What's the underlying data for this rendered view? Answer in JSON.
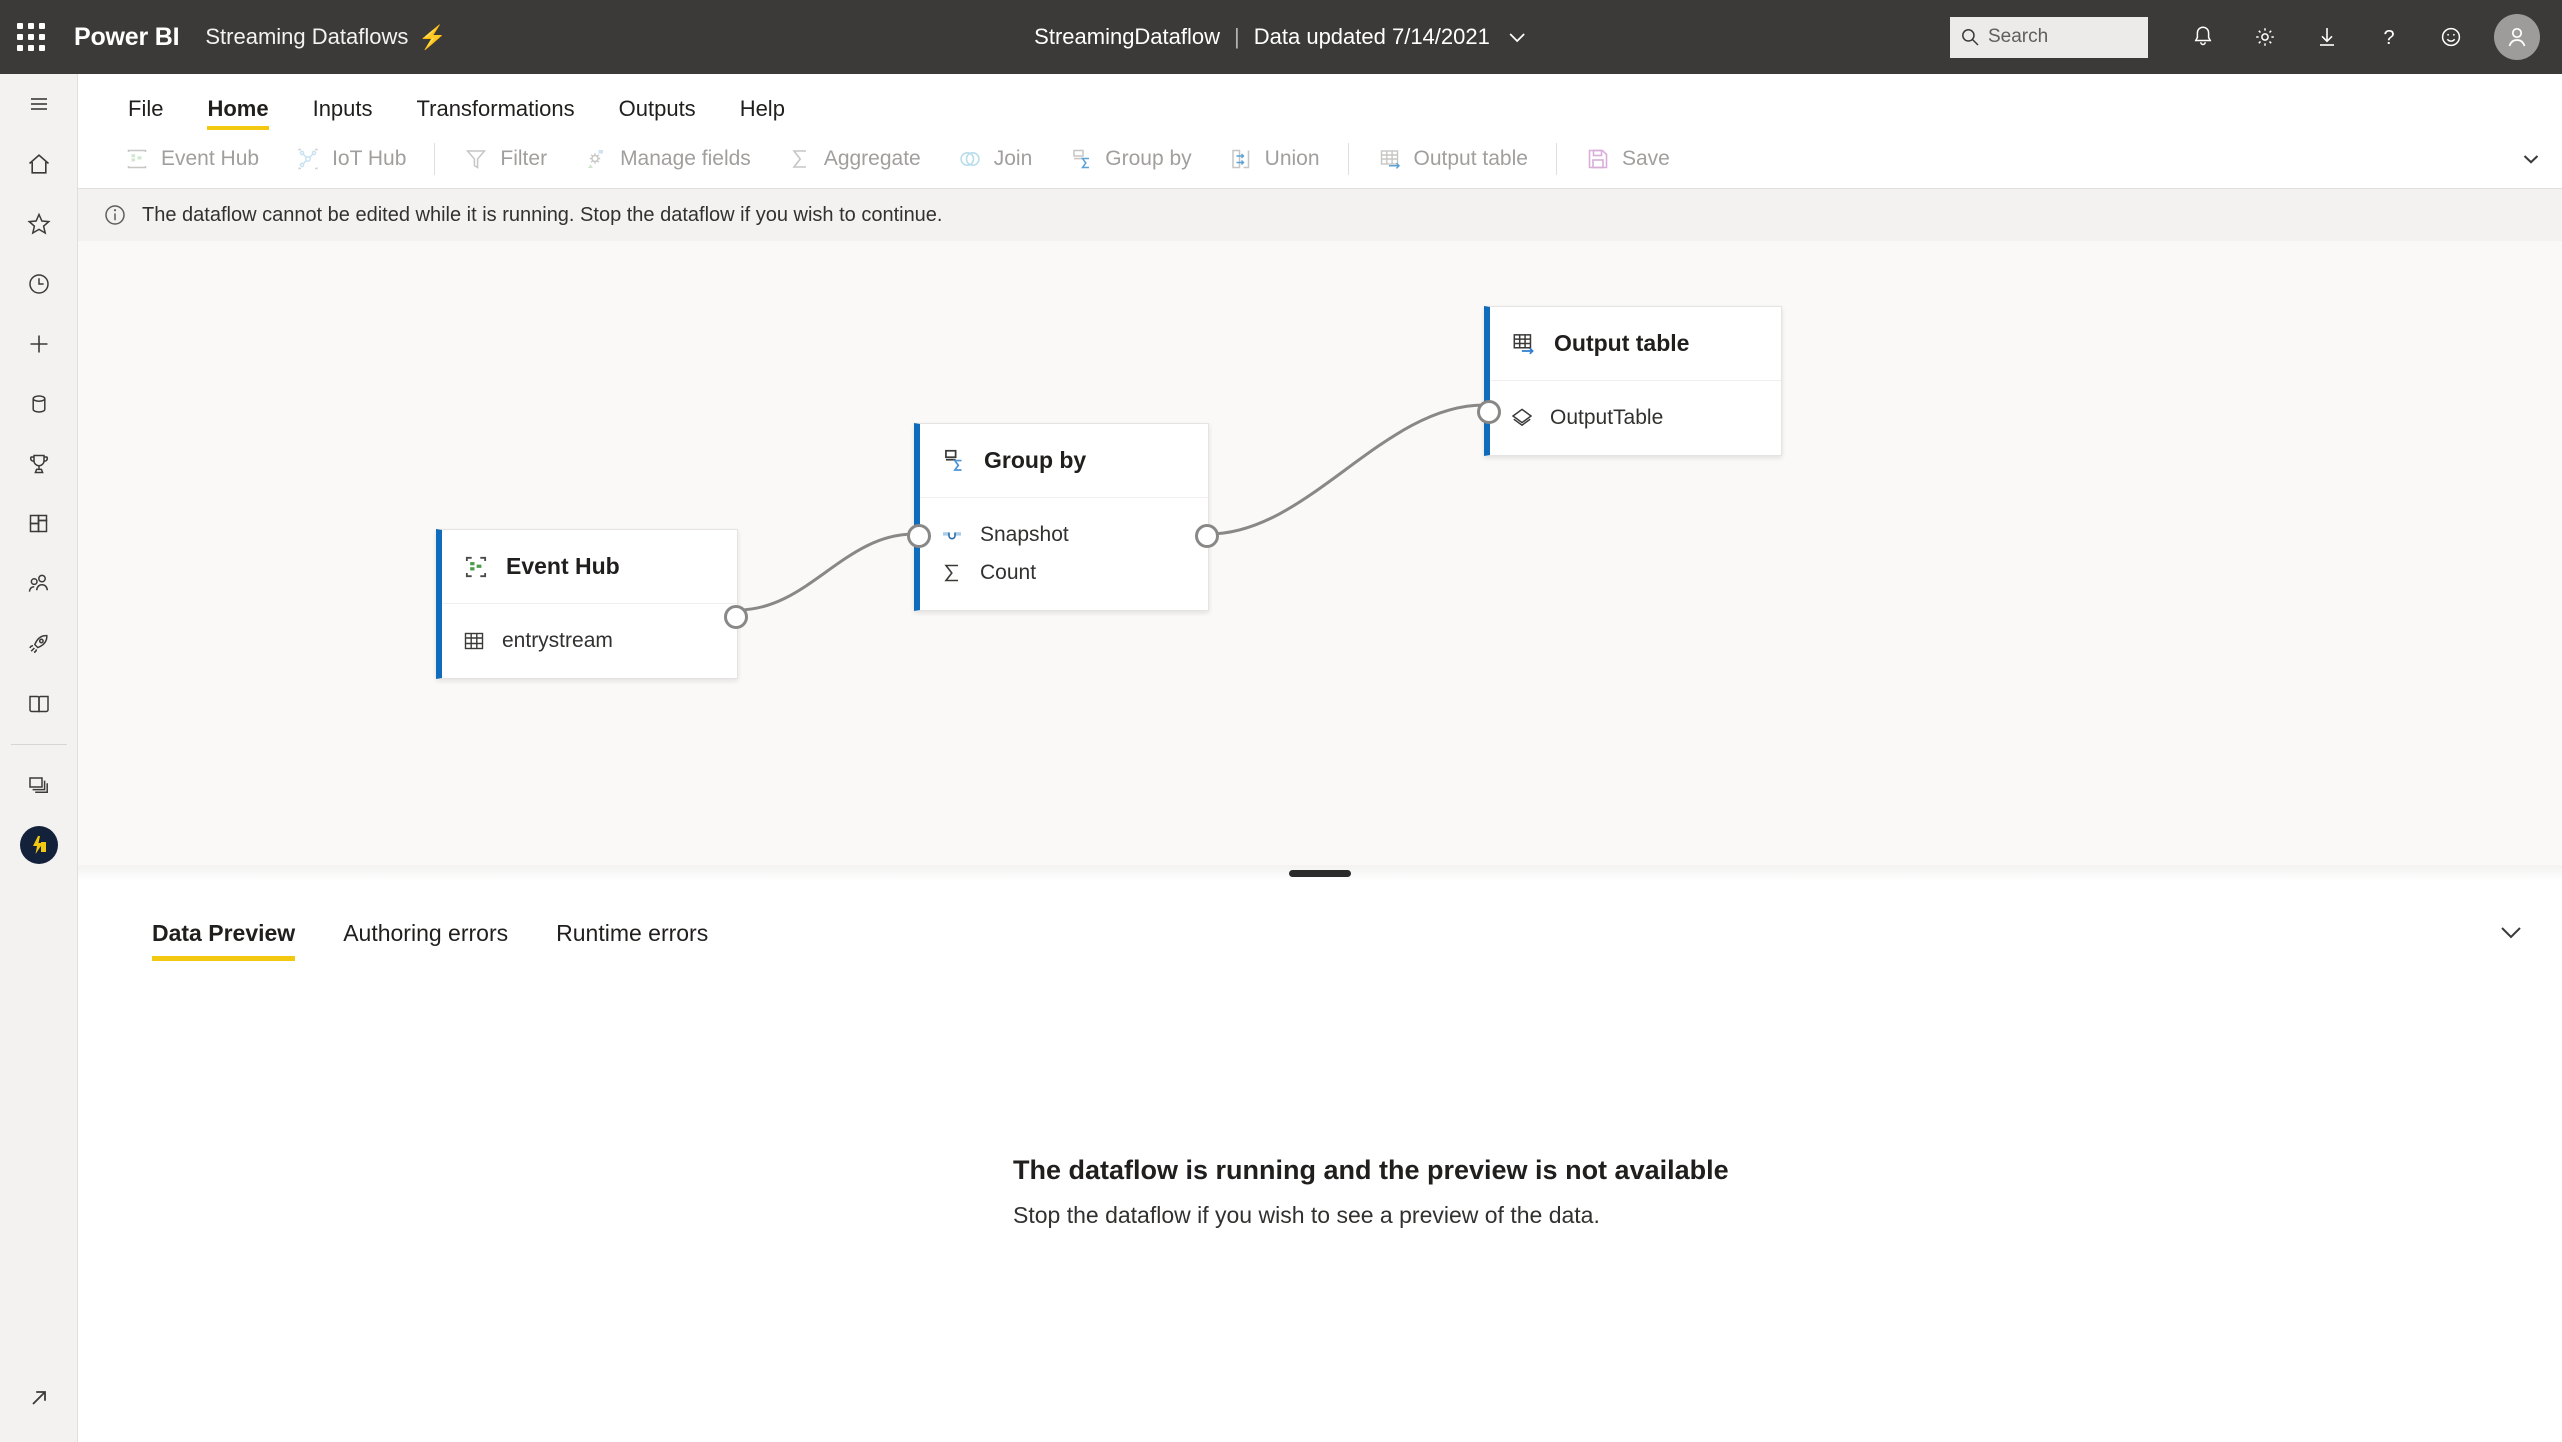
{
  "topbar": {
    "waffle_label": "app-launcher",
    "brand": "Power BI",
    "app_name": "Streaming Dataflows",
    "bolt_glyph": "⚡",
    "center": {
      "dataflow_name": "StreamingDataflow",
      "separator": "|",
      "updated_label": "Data updated 7/14/2021"
    },
    "search": {
      "placeholder": "Search",
      "value": "Search"
    },
    "icons": [
      {
        "name": "notifications-icon",
        "label": "Notifications"
      },
      {
        "name": "settings-gear-icon",
        "label": "Settings"
      },
      {
        "name": "download-icon",
        "label": "Download"
      },
      {
        "name": "help-question-icon",
        "label": "Help"
      },
      {
        "name": "feedback-smiley-icon",
        "label": "Feedback"
      }
    ],
    "avatar_label": "Account manager"
  },
  "rail": {
    "items": [
      {
        "name": "hamburger-menu-icon",
        "label": "Navigation"
      },
      {
        "name": "home-icon",
        "label": "Home"
      },
      {
        "name": "favorites-star-icon",
        "label": "Favorites"
      },
      {
        "name": "recent-clock-icon",
        "label": "Recent"
      },
      {
        "name": "create-plus-icon",
        "label": "Create"
      },
      {
        "name": "datahub-cylinder-icon",
        "label": "Data hub"
      },
      {
        "name": "goals-trophy-icon",
        "label": "Goals"
      },
      {
        "name": "apps-grid-icon",
        "label": "Apps"
      },
      {
        "name": "shared-people-icon",
        "label": "Shared with me"
      },
      {
        "name": "deployment-rocket-icon",
        "label": "Deployment pipelines"
      },
      {
        "name": "learn-book-icon",
        "label": "Learn"
      },
      {
        "name": "workspaces-stack-icon",
        "label": "Workspaces"
      },
      {
        "name": "current-workspace-icon",
        "label": "Streaming workspace"
      }
    ],
    "bottom_item": {
      "name": "open-external-arrow-icon",
      "label": "Open in new window"
    }
  },
  "ribbon": {
    "menu": [
      {
        "label": "File",
        "active": false
      },
      {
        "label": "Home",
        "active": true
      },
      {
        "label": "Inputs",
        "active": false
      },
      {
        "label": "Transformations",
        "active": false
      },
      {
        "label": "Outputs",
        "active": false
      },
      {
        "label": "Help",
        "active": false
      }
    ],
    "toolbar": [
      {
        "label": "Event Hub",
        "icon": "event-hub-icon",
        "disabled": true
      },
      {
        "label": "IoT Hub",
        "icon": "iot-hub-icon",
        "disabled": true
      },
      {
        "sep": true
      },
      {
        "label": "Filter",
        "icon": "filter-funnel-icon",
        "disabled": true
      },
      {
        "label": "Manage fields",
        "icon": "manage-fields-icon",
        "disabled": true
      },
      {
        "label": "Aggregate",
        "icon": "aggregate-sigma-icon",
        "disabled": true
      },
      {
        "label": "Join",
        "icon": "join-venn-icon",
        "disabled": true
      },
      {
        "label": "Group by",
        "icon": "group-by-icon",
        "disabled": true
      },
      {
        "label": "Union",
        "icon": "union-icon",
        "disabled": true
      },
      {
        "sep": true
      },
      {
        "label": "Output table",
        "icon": "output-table-icon",
        "disabled": true
      },
      {
        "sep": true
      },
      {
        "label": "Save",
        "icon": "save-floppy-icon",
        "disabled": true
      }
    ],
    "expand_icon": "chevron-down-icon"
  },
  "infobar": {
    "icon": "info-circle-icon",
    "message": "The dataflow cannot be edited while it is running. Stop the dataflow if you wish to continue."
  },
  "canvas": {
    "nodes": [
      {
        "id": "event-hub",
        "title": "Event Hub",
        "title_icon": "event-hub-icon",
        "accent": "#0f6cbd",
        "rows": [
          {
            "label": "entrystream",
            "icon": "table-grid-icon"
          }
        ]
      },
      {
        "id": "group-by",
        "title": "Group by",
        "title_icon": "group-by-icon",
        "accent": "#0f6cbd",
        "rows": [
          {
            "label": "Snapshot",
            "icon": "snapshot-window-icon"
          },
          {
            "label": "Count",
            "icon": "sigma-icon"
          }
        ]
      },
      {
        "id": "output-table",
        "title": "Output table",
        "title_icon": "output-table-icon",
        "accent": "#0f6cbd",
        "rows": [
          {
            "label": "OutputTable",
            "icon": "layers-diamond-icon"
          }
        ]
      }
    ],
    "edges": [
      {
        "from": "event-hub",
        "to": "group-by"
      },
      {
        "from": "group-by",
        "to": "output-table"
      }
    ],
    "splitter_name": "panel-resize-grip"
  },
  "bottom_panel": {
    "tabs": [
      {
        "label": "Data Preview",
        "active": true
      },
      {
        "label": "Authoring errors",
        "active": false
      },
      {
        "label": "Runtime errors",
        "active": false
      }
    ],
    "collapse_icon": "chevron-down-icon",
    "empty_state": {
      "title": "The dataflow is running and the preview is not available",
      "subtitle": "Stop the dataflow if you wish to see a preview of the data."
    }
  },
  "colors": {
    "topbar_bg": "#3b3a39",
    "accent_yellow": "#f2c811",
    "node_accent_blue": "#0f6cbd",
    "rail_bg": "#f3f2f1",
    "canvas_bg": "#faf9f8"
  }
}
